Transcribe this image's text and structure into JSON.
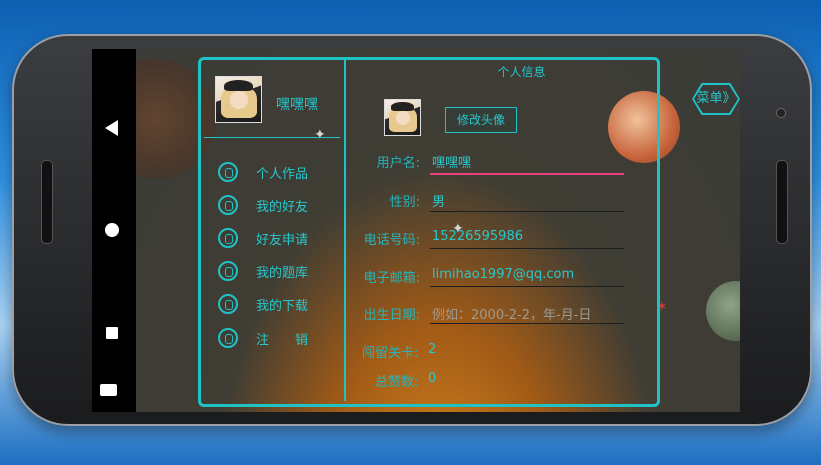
{
  "panel": {
    "title": "个人信息"
  },
  "sidebar": {
    "username": "嘿嘿嘿",
    "items": [
      {
        "label": "个人作品",
        "icon": "user-works-icon"
      },
      {
        "label": "我的好友",
        "icon": "friends-icon"
      },
      {
        "label": "好友申请",
        "icon": "friend-request-icon"
      },
      {
        "label": "我的题库",
        "icon": "question-bank-icon"
      },
      {
        "label": "我的下载",
        "icon": "download-icon"
      },
      {
        "label": "注　　销",
        "icon": "settings-icon"
      }
    ]
  },
  "profile": {
    "edit_avatar_label": "修改头像",
    "menu_label": "菜单》",
    "fields": [
      {
        "label": "用户名:",
        "value": "嘿嘿嘿"
      },
      {
        "label": "性别:",
        "value": "男"
      },
      {
        "label": "电话号码:",
        "value": "15226595986"
      },
      {
        "label": "电子邮箱:",
        "value": "limihao1997@qq.com"
      },
      {
        "label": "出生日期:",
        "value": "",
        "placeholder": "例如：2000-2-2，年-月-日"
      }
    ],
    "stats": [
      {
        "label": "闯留关卡:",
        "value": "2"
      },
      {
        "label": "总赞数:",
        "value": "0"
      }
    ]
  },
  "colors": {
    "accent": "#1fc3c6",
    "active_underline": "#e9417f"
  }
}
